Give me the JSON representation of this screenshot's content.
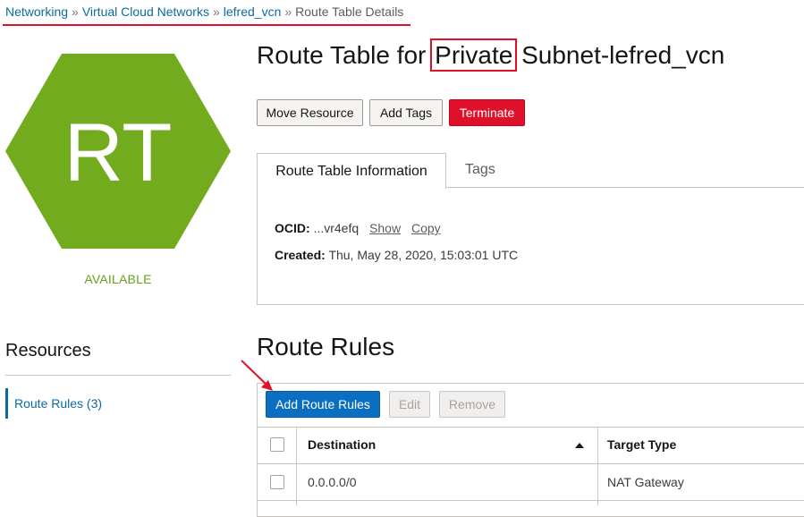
{
  "breadcrumb": {
    "items": [
      "Networking",
      "Virtual Cloud Networks",
      "lefred_vcn"
    ],
    "separator": "»",
    "current": "Route Table Details"
  },
  "resource": {
    "abbr": "RT",
    "status": "AVAILABLE",
    "hex_color": "#73ab1f",
    "status_color": "#6aa118"
  },
  "title": {
    "prefix": "Route Table for",
    "highlight": "Private",
    "suffix": "Subnet-lefred_vcn"
  },
  "actions": {
    "move": "Move Resource",
    "tags": "Add Tags",
    "terminate": "Terminate"
  },
  "tabs": {
    "info": "Route Table Information",
    "tags": "Tags"
  },
  "info": {
    "ocid_label": "OCID:",
    "ocid_value": "...vr4efq",
    "show": "Show",
    "copy": "Copy",
    "created_label": "Created:",
    "created_value": "Thu, May 28, 2020, 15:03:01 UTC"
  },
  "resources": {
    "title": "Resources",
    "items": [
      {
        "label": "Route Rules (3)"
      }
    ]
  },
  "route_rules": {
    "title": "Route Rules",
    "add": "Add Route Rules",
    "edit": "Edit",
    "remove": "Remove",
    "columns": [
      "Destination",
      "Target Type"
    ],
    "rows": [
      {
        "destination": "0.0.0.0/0",
        "target_type": "NAT Gateway"
      }
    ]
  },
  "colors": {
    "accent": "#0b6fc1",
    "danger": "#e0102a",
    "link": "#0a6aa1"
  }
}
